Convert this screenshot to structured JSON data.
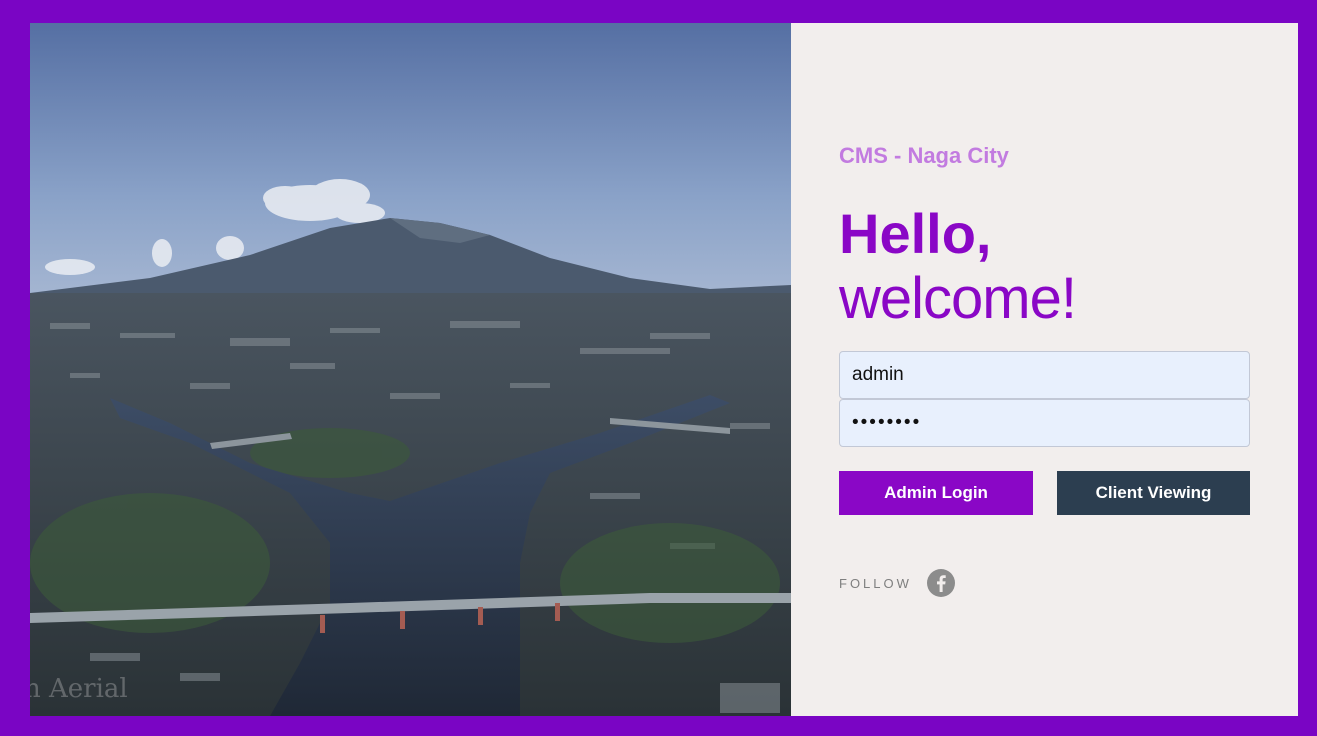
{
  "brand": {
    "title": "CMS - Naga City"
  },
  "greeting": {
    "line1": "Hello,",
    "line2": "welcome!"
  },
  "login": {
    "username_value": "admin",
    "password_value": "••••••••"
  },
  "buttons": {
    "admin_login": "Admin Login",
    "client_viewing": "Client Viewing"
  },
  "social": {
    "follow_label": "FOLLOW",
    "icon": "facebook-icon"
  },
  "hero": {
    "watermark": "n Aerial"
  },
  "colors": {
    "frame": "#7a05c4",
    "accent": "#8a07c6",
    "brand_text": "#c27be0",
    "client_button": "#2c3e50",
    "panel_bg": "#f2eeed"
  }
}
